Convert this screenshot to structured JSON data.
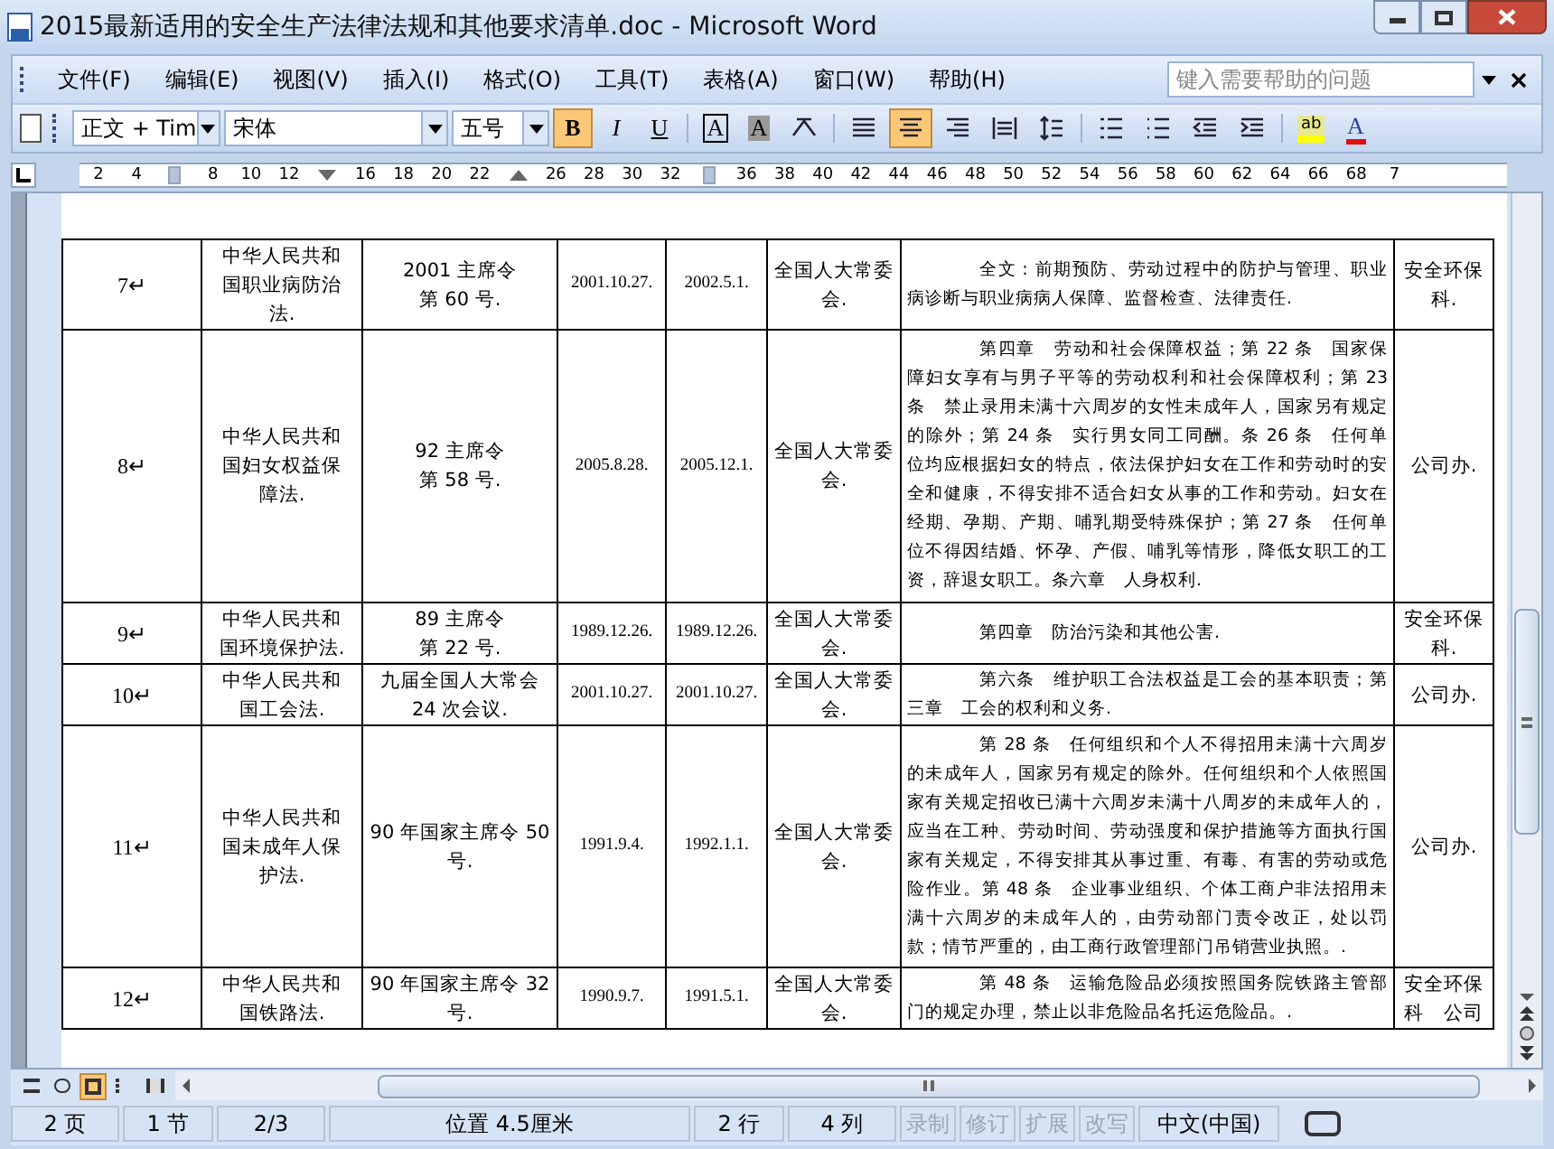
{
  "window": {
    "title": "2015最新适用的安全生产法律法规和其他要求清单.doc - Microsoft Word"
  },
  "menu": [
    {
      "label": "文件(F)"
    },
    {
      "label": "编辑(E)"
    },
    {
      "label": "视图(V)"
    },
    {
      "label": "插入(I)"
    },
    {
      "label": "格式(O)"
    },
    {
      "label": "工具(T)"
    },
    {
      "label": "表格(A)"
    },
    {
      "label": "窗口(W)"
    },
    {
      "label": "帮助(H)"
    }
  ],
  "help_search": {
    "placeholder": "键入需要帮助的问题"
  },
  "toolbar": {
    "style": "正文 + Tim",
    "font": "宋体",
    "size": "五号",
    "buttons": [
      {
        "kind": "bold",
        "label": "B",
        "selected": true
      },
      {
        "kind": "italic",
        "label": "I",
        "selected": false
      },
      {
        "kind": "underline",
        "label": "U",
        "selected": false
      },
      {
        "kind": "border-char",
        "label": "A",
        "selected": false
      },
      {
        "kind": "shade-char",
        "label": "A",
        "selected": false
      },
      {
        "kind": "scale",
        "selected": false
      },
      {
        "kind": "align-justify",
        "selected": false
      },
      {
        "kind": "align-center",
        "selected": true
      },
      {
        "kind": "align-right",
        "selected": false
      },
      {
        "kind": "align-distribute",
        "selected": false
      },
      {
        "kind": "line-spacing",
        "selected": false
      },
      {
        "kind": "numbering",
        "selected": false
      },
      {
        "kind": "bullets",
        "selected": false
      },
      {
        "kind": "outdent",
        "selected": false
      },
      {
        "kind": "indent",
        "selected": false
      },
      {
        "kind": "highlight",
        "label": "ab",
        "selected": false
      },
      {
        "kind": "font-color",
        "label": "A",
        "selected": false
      }
    ]
  },
  "ruler": [
    {
      "kind": "number",
      "label": "2"
    },
    {
      "kind": "number",
      "label": "4"
    },
    {
      "kind": "column-marker"
    },
    {
      "kind": "number",
      "label": "8"
    },
    {
      "kind": "number",
      "label": "10"
    },
    {
      "kind": "number",
      "label": "12"
    },
    {
      "kind": "indent-marker"
    },
    {
      "kind": "number",
      "label": "16"
    },
    {
      "kind": "number",
      "label": "18"
    },
    {
      "kind": "number",
      "label": "20"
    },
    {
      "kind": "number",
      "label": "22"
    },
    {
      "kind": "tab-marker"
    },
    {
      "kind": "number",
      "label": "26"
    },
    {
      "kind": "number",
      "label": "28"
    },
    {
      "kind": "number",
      "label": "30"
    },
    {
      "kind": "number",
      "label": "32"
    },
    {
      "kind": "column-marker"
    },
    {
      "kind": "number",
      "label": "36"
    },
    {
      "kind": "number",
      "label": "38"
    },
    {
      "kind": "number",
      "label": "40"
    },
    {
      "kind": "number",
      "label": "42"
    },
    {
      "kind": "number",
      "label": "44"
    },
    {
      "kind": "number",
      "label": "46"
    },
    {
      "kind": "number",
      "label": "48"
    },
    {
      "kind": "number",
      "label": "50"
    },
    {
      "kind": "number",
      "label": "52"
    },
    {
      "kind": "number",
      "label": "54"
    },
    {
      "kind": "number",
      "label": "56"
    },
    {
      "kind": "number",
      "label": "58"
    },
    {
      "kind": "number",
      "label": "60"
    },
    {
      "kind": "number",
      "label": "62"
    },
    {
      "kind": "number",
      "label": "64"
    },
    {
      "kind": "number",
      "label": "66"
    },
    {
      "kind": "number",
      "label": "68"
    },
    {
      "kind": "number",
      "label": "7"
    }
  ],
  "table": {
    "rows": [
      {
        "no": "7↵",
        "name": "中华人民共和国职业病防治法.",
        "order": [
          "2001 主席令",
          "第 60 号."
        ],
        "issued": "2001.10.27.",
        "effective": "2002.5.1.",
        "authority": "全国人大常委会.",
        "content": "全文：前期预防、劳动过程中的防护与管理、职业病诊断与职业病病人保障、监督检查、法律责任.",
        "dept": "安全环保科."
      },
      {
        "no": "8↵",
        "name": "中华人民共和国妇女权益保障法.",
        "order": [
          "92 主席令",
          "第 58 号."
        ],
        "issued": "2005.8.28.",
        "effective": "2005.12.1.",
        "authority": "全国人大常委会.",
        "content": "第四章　劳动和社会保障权益；第 22 条　国家保障妇女享有与男子平等的劳动权利和社会保障权利；第 23 条　禁止录用未满十六周岁的女性未成年人，国家另有规定的除外；第 24 条　实行男女同工同酬。条 26 条　任何单位均应根据妇女的特点，依法保护妇女在工作和劳动时的安全和健康，不得安排不适合妇女从事的工作和劳动。妇女在经期、孕期、产期、哺乳期受特殊保护；第 27 条　任何单位不得因结婚、怀孕、产假、哺乳等情形，降低女职工的工资，辞退女职工。条六章　人身权利.",
        "dept": "公司办."
      },
      {
        "no": "9↵",
        "name": "中华人民共和国环境保护法.",
        "order": [
          "89 主席令",
          "第 22 号."
        ],
        "issued": "1989.12.26.",
        "effective": "1989.12.26.",
        "authority": "全国人大常委会.",
        "content": "第四章　防治污染和其他公害.",
        "dept": "安全环保科."
      },
      {
        "no": "10↵",
        "name": "中华人民共和国工会法.",
        "order": [
          "九届全国人大常会",
          "24 次会议."
        ],
        "issued": "2001.10.27.",
        "effective": "2001.10.27.",
        "authority": "全国人大常委会.",
        "content": "第六条　维护职工合法权益是工会的基本职责；第三章　工会的权利和义务.",
        "dept": "公司办."
      },
      {
        "no": "11↵",
        "name": "中华人民共和国未成年人保护法.",
        "order": [
          "90 年国家主席令 50 号."
        ],
        "issued": "1991.9.4.",
        "effective": "1992.1.1.",
        "authority": "全国人大常委会.",
        "content": "第 28 条　任何组织和个人不得招用未满十六周岁的未成年人，国家另有规定的除外。任何组织和个人依照国家有关规定招收已满十六周岁未满十八周岁的未成年人的，应当在工种、劳动时间、劳动强度和保护措施等方面执行国家有关规定，不得安排其从事过重、有毒、有害的劳动或危险作业。第 48 条　企业事业组织、个体工商户非法招用未满十六周岁的未成年人的，由劳动部门责令改正，处以罚款；情节严重的，由工商行政管理部门吊销营业执照。.",
        "dept": "公司办."
      },
      {
        "no": "12↵",
        "name": "中华人民共和国铁路法.",
        "order": [
          "90 年国家主席令 32 号."
        ],
        "issued": "1990.9.7.",
        "effective": "1991.5.1.",
        "authority": "全国人大常委会.",
        "content": "第 48 条　运输危险品必须按照国务院铁路主管部门的规定办理，禁止以非危险品名托运危险品。.",
        "dept": "安全环保科　公司"
      }
    ]
  },
  "view_buttons": [
    {
      "kind": "normal",
      "selected": false
    },
    {
      "kind": "web",
      "selected": false
    },
    {
      "kind": "print",
      "selected": true
    },
    {
      "kind": "outline",
      "selected": false
    },
    {
      "kind": "reading",
      "selected": false
    }
  ],
  "status_bar": [
    {
      "label": "2 页",
      "disabled": false
    },
    {
      "label": "1 节",
      "disabled": false
    },
    {
      "label": "2/3",
      "disabled": false
    },
    {
      "label": "位置 4.5厘米",
      "disabled": false
    },
    {
      "label": "2 行",
      "disabled": false
    },
    {
      "label": "4 列",
      "disabled": false
    },
    {
      "label": "录制",
      "disabled": true
    },
    {
      "label": "修订",
      "disabled": true
    },
    {
      "label": "扩展",
      "disabled": true
    },
    {
      "label": "改写",
      "disabled": true
    },
    {
      "label": "中文(中国)",
      "disabled": false
    }
  ]
}
